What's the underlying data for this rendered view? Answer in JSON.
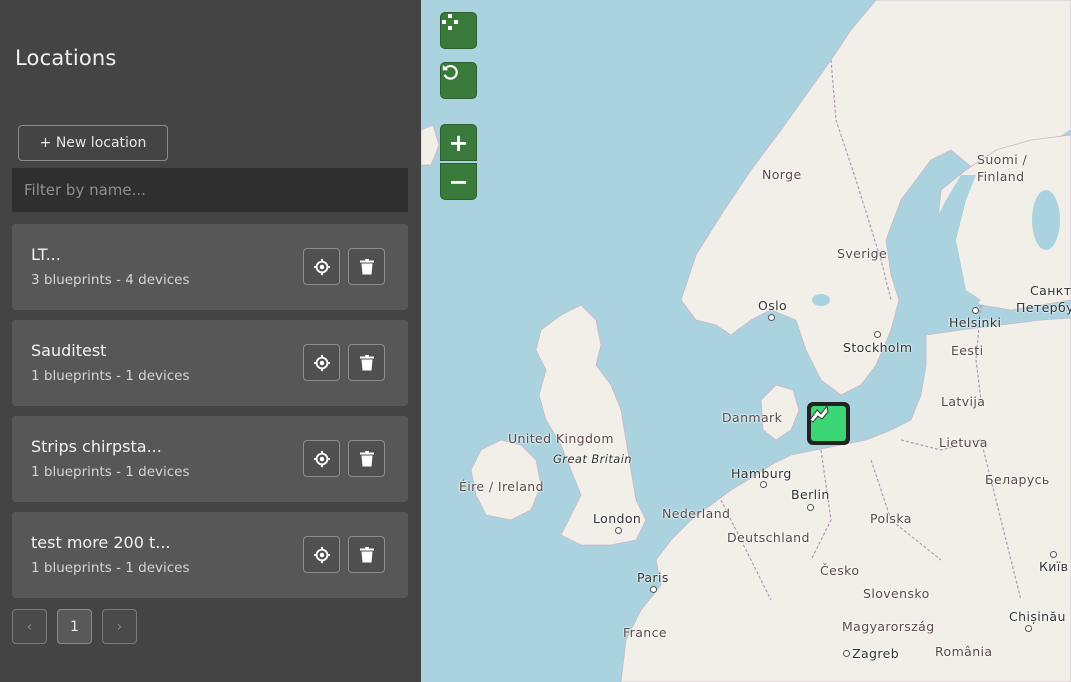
{
  "sidebar": {
    "title": "Locations",
    "new_location_label": "+ New location",
    "filter_placeholder": "Filter by name...",
    "locations": [
      {
        "name": "LT...",
        "summary": "3 blueprints - 4 devices"
      },
      {
        "name": "Sauditest",
        "summary": "1 blueprints - 1 devices"
      },
      {
        "name": "Strips chirpsta...",
        "summary": "1 blueprints - 1 devices"
      },
      {
        "name": "test more 200 t...",
        "summary": "1 blueprints - 1 devices"
      }
    ],
    "pagination": {
      "prev": "‹",
      "current": "1",
      "next": "›"
    }
  },
  "map": {
    "controls": {
      "fit_icon": "scatter-fit-icon",
      "reset_icon": "rotate-ccw-icon",
      "zoom_in": "+",
      "zoom_out": "−"
    },
    "labels": {
      "norge": "Norge",
      "sverige": "Sverige",
      "suomi": "Suomi /",
      "finland": "Finland",
      "spb1": "Санкт-",
      "spb2": "Петербу",
      "oslo": "Oslo",
      "stockholm": "Stockholm",
      "helsinki": "Helsinki",
      "eesti": "Eesti",
      "latvija": "Latvija",
      "lietuva": "Lietuva",
      "belarus": "Беларусь",
      "danmark": "Danmark",
      "uk": "United Kingdom",
      "gb": "Great Britain",
      "eire": "Éire / Ireland",
      "hamburg": "Hamburg",
      "berlin": "Berlin",
      "london": "London",
      "nederland": "Nederland",
      "deutschland": "Deutschland",
      "polska": "Polska",
      "kyiv": "Київ",
      "paris": "Paris",
      "cesko": "Česko",
      "slovensko": "Slovensko",
      "chisinau": "Chișinău",
      "france": "France",
      "magyar": "Magyarország",
      "zagreb": "Zagreb",
      "romania": "România"
    },
    "colors": {
      "water": "#aad3df",
      "land": "#f2efe9",
      "control": "#3a7a3a",
      "marker": "#3dd676"
    }
  }
}
